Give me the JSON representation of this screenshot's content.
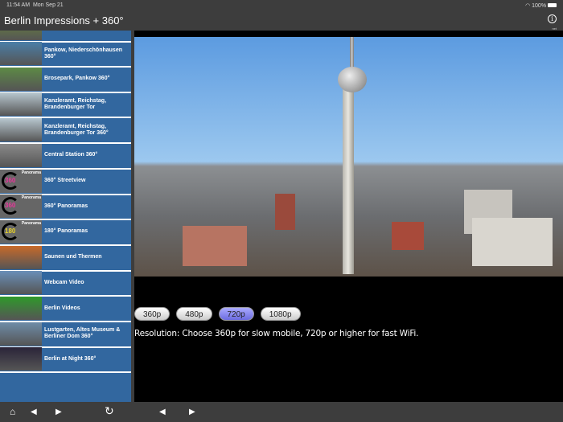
{
  "status": {
    "time": "11:54 AM",
    "date": "Mon Sep 21",
    "battery": "100%"
  },
  "header": {
    "title": "Berlin Impressions + 360°",
    "info_label": "net"
  },
  "sidebar": {
    "items": [
      {
        "label": "",
        "thumb": "#6b8a3a"
      },
      {
        "label": "Pankow, Niederschönhausen 360°",
        "thumb": "#4a7fa8"
      },
      {
        "label": "Brosepark, Pankow 360°",
        "thumb": "#5d8a45"
      },
      {
        "label": "Kanzleramt, Reichstag, Brandenburger Tor",
        "thumb": "#b8c8d0"
      },
      {
        "label": "Kanzleramt, Reichstag, Brandenburger Tor 360°",
        "thumb": "#b8c8d0"
      },
      {
        "label": "Central Station 360°",
        "thumb": "#8a8a8a"
      },
      {
        "label": "360° Streetview",
        "thumb": "pano",
        "num": "360"
      },
      {
        "label": "360° Panoramas",
        "thumb": "pano",
        "num": "360"
      },
      {
        "label": "180° Panoramas",
        "thumb": "pano",
        "num": "180"
      },
      {
        "label": "Saunen und Thermen",
        "thumb": "#c86a2a"
      },
      {
        "label": "Webcam Video",
        "thumb": "#6a8fb8"
      },
      {
        "label": "Berlin Videos",
        "thumb": "#2f9a2a"
      },
      {
        "label": "Lustgarten, Altes Museum & Berliner Dom 360°",
        "thumb": "#6e8ca8"
      },
      {
        "label": "Berlin at Night 360°",
        "thumb": "#2a2438"
      }
    ],
    "panorama_label": "Panorama"
  },
  "main": {
    "resolutions": [
      {
        "label": "360p"
      },
      {
        "label": "480p"
      },
      {
        "label": "720p",
        "selected": true
      },
      {
        "label": "1080p"
      }
    ],
    "hint": "Resolution: Choose 360p for slow mobile, 720p or higher for fast WiFi."
  },
  "toolbar": {
    "home": "⌂",
    "back": "◀",
    "forward": "▶",
    "reload": "↻",
    "back2": "◀",
    "forward2": "▶"
  }
}
